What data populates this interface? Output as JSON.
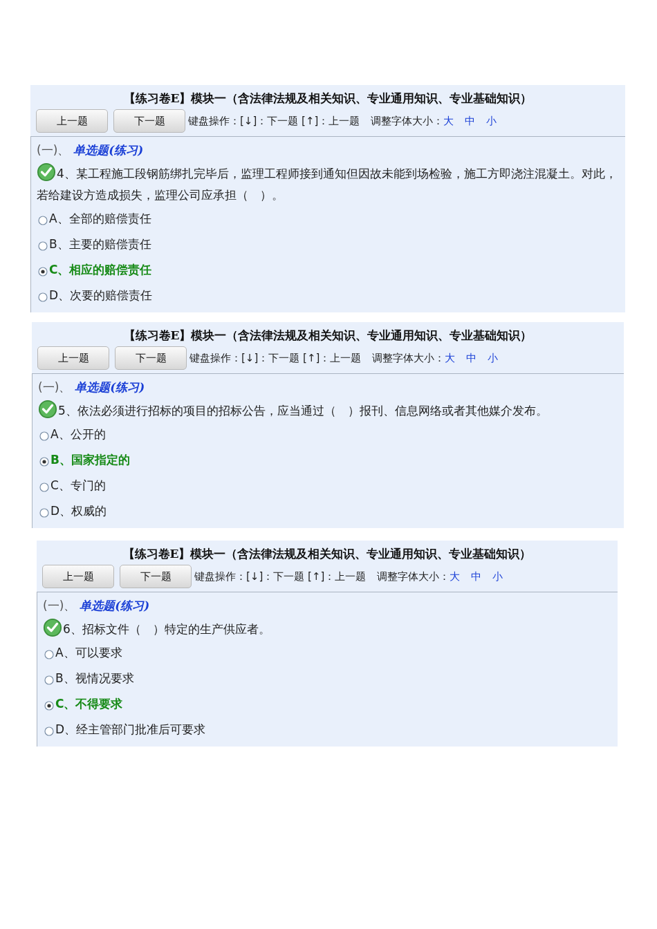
{
  "panels": [
    {
      "title": "【练习卷E】模块一（含法律法规及相关知识、专业通用知识、专业基础知识）",
      "buttons": [
        "上一题",
        "下一题"
      ],
      "keyboard_hint": "键盘操作：[↓]：下一题 [↑]：上一题",
      "font_size_label": "调整字体大小：",
      "font_sizes": [
        "大",
        "中",
        "小"
      ],
      "section_number": "(一)、",
      "section_type": "单选题(练习)",
      "question": "4、某工程施工段钢筋绑扎完毕后，监理工程师接到通知但因故未能到场检验，施工方即浇注混凝土。对此，若给建设方造成损失，监理公司应承担（　）。",
      "options": [
        {
          "text": "A、全部的赔偿责任",
          "selected": false
        },
        {
          "text": "B、主要的赔偿责任",
          "selected": false
        },
        {
          "text": "C、相应的赔偿责任",
          "selected": true
        },
        {
          "text": "D、次要的赔偿责任",
          "selected": false
        }
      ]
    },
    {
      "title": "【练习卷E】模块一（含法律法规及相关知识、专业通用知识、专业基础知识）",
      "buttons": [
        "上一题",
        "下一题"
      ],
      "keyboard_hint": "键盘操作：[↓]：下一题 [↑]：上一题",
      "font_size_label": "调整字体大小：",
      "font_sizes": [
        "大",
        "中",
        "小"
      ],
      "section_number": "(一)、",
      "section_type": "单选题(练习)",
      "question": "5、依法必须进行招标的项目的招标公告，应当通过（　）报刊、信息网络或者其他媒介发布。",
      "options": [
        {
          "text": "A、公开的",
          "selected": false
        },
        {
          "text": "B、国家指定的",
          "selected": true
        },
        {
          "text": "C、专门的",
          "selected": false
        },
        {
          "text": "D、权威的",
          "selected": false
        }
      ]
    },
    {
      "title": "【练习卷E】模块一（含法律法规及相关知识、专业通用知识、专业基础知识）",
      "buttons": [
        "上一题",
        "下一题"
      ],
      "keyboard_hint": "键盘操作：[↓]：下一题 [↑]：上一题",
      "font_size_label": "调整字体大小：",
      "font_sizes": [
        "大",
        "中",
        "小"
      ],
      "section_number": "(一)、",
      "section_type": "单选题(练习)",
      "question": "6、招标文件（　）特定的生产供应者。",
      "options": [
        {
          "text": "A、可以要求",
          "selected": false
        },
        {
          "text": "B、视情况要求",
          "selected": false
        },
        {
          "text": "C、不得要求",
          "selected": true
        },
        {
          "text": "D、经主管部门批准后可要求",
          "selected": false
        }
      ]
    }
  ]
}
